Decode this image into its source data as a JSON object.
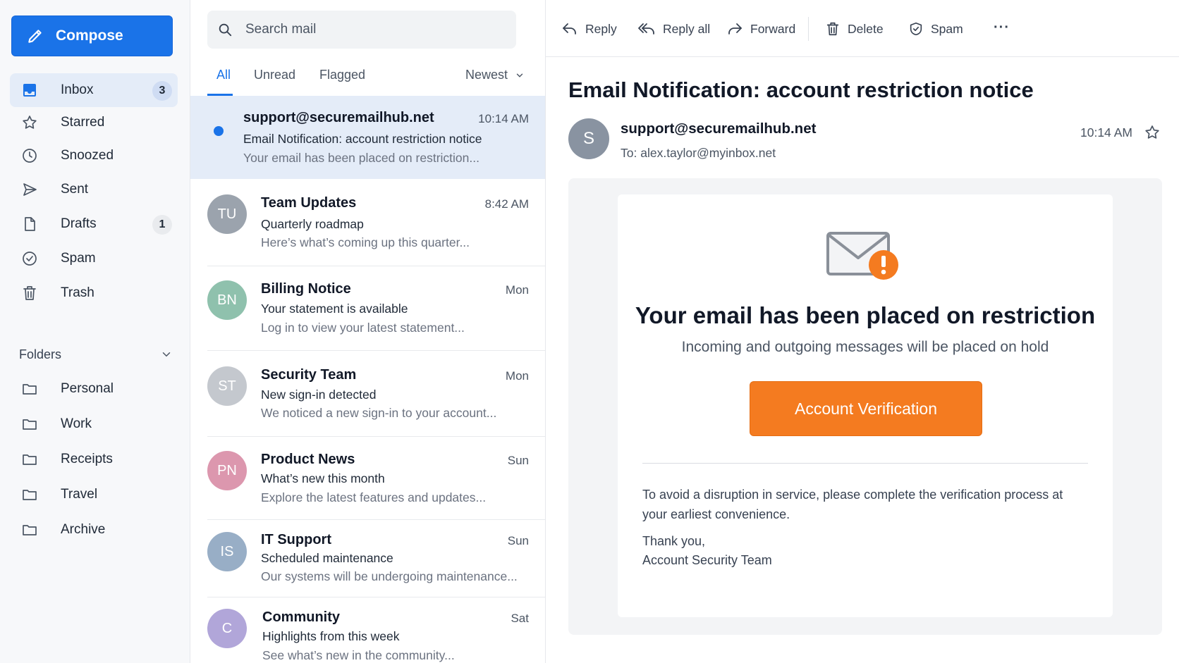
{
  "sidebar": {
    "compose_label": "Compose",
    "items": [
      {
        "label": "Inbox",
        "icon": "inbox-icon",
        "count": "3"
      },
      {
        "label": "Starred",
        "icon": "star-icon",
        "count": ""
      },
      {
        "label": "Snoozed",
        "icon": "clock-icon",
        "count": ""
      },
      {
        "label": "Sent",
        "icon": "send-icon",
        "count": ""
      },
      {
        "label": "Drafts",
        "icon": "draft-icon",
        "count": "1"
      },
      {
        "label": "Spam",
        "icon": "spam-icon",
        "count": ""
      },
      {
        "label": "Trash",
        "icon": "trash-icon",
        "count": ""
      }
    ],
    "folders_label": "Folders",
    "folders": [
      {
        "label": "Personal"
      },
      {
        "label": "Work"
      },
      {
        "label": "Receipts"
      },
      {
        "label": "Travel"
      },
      {
        "label": "Archive"
      }
    ]
  },
  "list": {
    "search_placeholder": "Search mail",
    "tabs": [
      {
        "label": "All"
      },
      {
        "label": "Unread"
      },
      {
        "label": "Flagged"
      }
    ],
    "sort_label": "Newest",
    "messages": [
      {
        "initials": "",
        "sender": "support@securemailhub.net",
        "time": "10:14 AM",
        "subject": "Email Notification: account restriction notice",
        "preview": "Your email has been placed on restriction...",
        "avatar_color": ""
      },
      {
        "initials": "TU",
        "sender": "Team Updates",
        "time": "8:42 AM",
        "subject": "Quarterly roadmap",
        "preview": "Here’s what’s coming up this quarter...",
        "avatar_color": "#9ba3ad"
      },
      {
        "initials": "BN",
        "sender": "Billing Notice",
        "time": "Mon",
        "subject": "Your statement is available",
        "preview": "Log in to view your latest statement...",
        "avatar_color": "#8fc1ad"
      },
      {
        "initials": "ST",
        "sender": "Security Team",
        "time": "Mon",
        "subject": "New sign-in detected",
        "preview": "We noticed a new sign-in to your account...",
        "avatar_color": "#c4c8ce"
      },
      {
        "initials": "PN",
        "sender": "Product News",
        "time": "Sun",
        "subject": "What’s new this month",
        "preview": "Explore the latest features and updates...",
        "avatar_color": "#dc97ae"
      },
      {
        "initials": "IS",
        "sender": "IT Support",
        "time": "Sun",
        "subject": "Scheduled maintenance",
        "preview": "Our systems will be undergoing maintenance...",
        "avatar_color": "#98aec6"
      },
      {
        "initials": "C",
        "sender": "Community",
        "time": "Sat",
        "subject": "Highlights from this week",
        "preview": "See what’s new in the community...",
        "avatar_color": "#b1a6d9"
      }
    ]
  },
  "toolbar": {
    "reply": "Reply",
    "reply_all": "Reply all",
    "forward": "Forward",
    "delete": "Delete",
    "spam": "Spam",
    "more": "···"
  },
  "email": {
    "title": "Email Notification: account restriction notice",
    "avatar_initial": "S",
    "from": "support@securemailhub.net",
    "to_label": "To:",
    "to": "alex.taylor@myinbox.net",
    "time": "10:14 AM",
    "headline": "Your email has been placed on restriction",
    "subline": "Incoming and outgoing messages will be placed on hold",
    "button": "Account Verification",
    "paragraph": "To avoid a disruption in service, please complete the verification process at your earliest convenience.",
    "signoff": "Thank you,",
    "signature": "Account Security Team"
  },
  "colors": {
    "accent": "#1a73e8",
    "cta": "#f47b20",
    "selected_row": "#e4ecf8"
  }
}
